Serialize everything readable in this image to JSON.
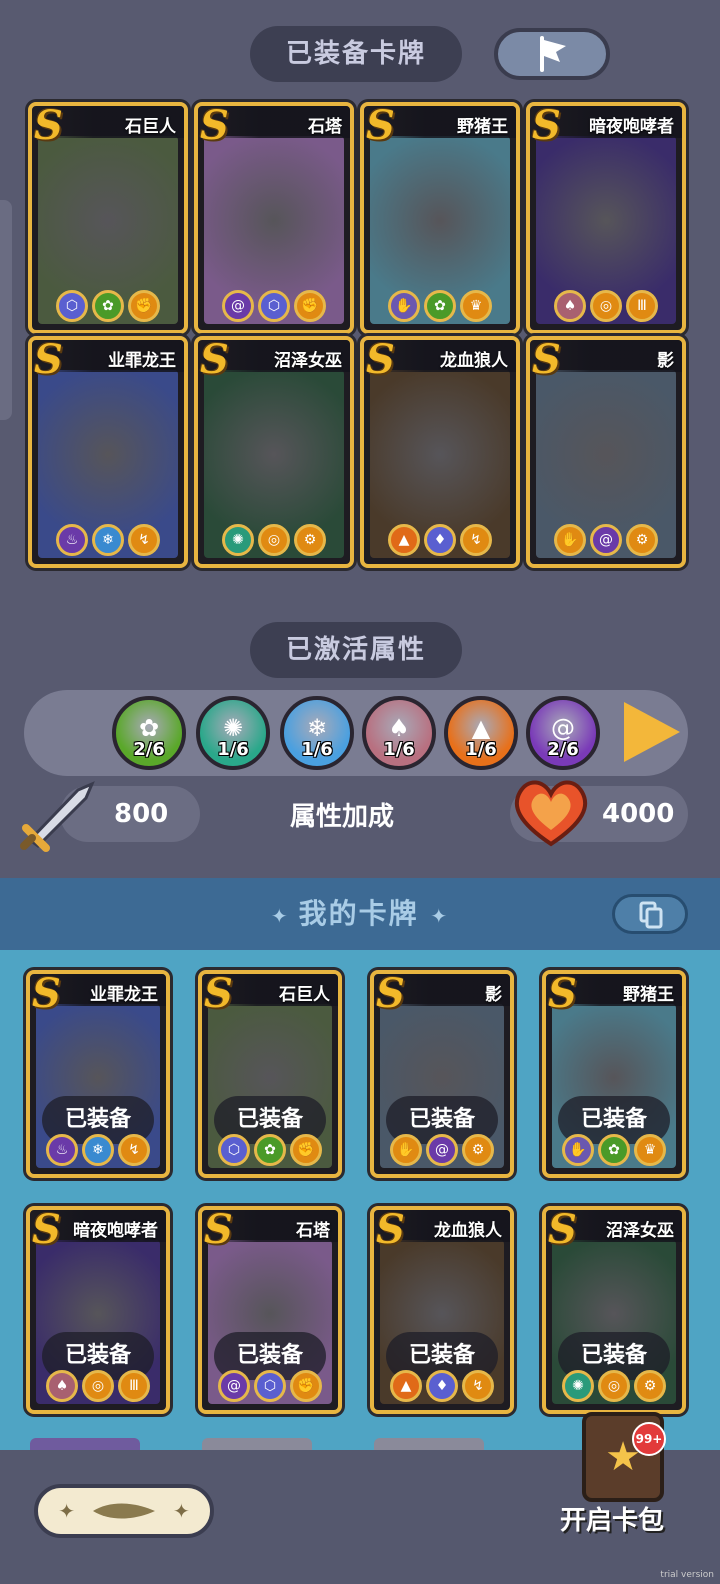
{
  "equipped_section": {
    "title": "已装备卡牌",
    "cards": [
      {
        "rank": "S",
        "name": "石巨人",
        "art": "#4b5a3f",
        "icons": [
          {
            "name": "rock-shield-icon",
            "color": "#5a5fd0",
            "glyph": "⬡"
          },
          {
            "name": "grass-icon",
            "color": "#4a9a28",
            "glyph": "✿"
          },
          {
            "name": "fist-icon",
            "color": "#e08a12",
            "glyph": "✊"
          }
        ]
      },
      {
        "rank": "S",
        "name": "石塔",
        "art": "#7a5a8a",
        "icons": [
          {
            "name": "vortex-icon",
            "color": "#6a3aa8",
            "glyph": "@"
          },
          {
            "name": "rock-shield-icon",
            "color": "#5a5fd0",
            "glyph": "⬡"
          },
          {
            "name": "fist-icon",
            "color": "#e08a12",
            "glyph": "✊"
          }
        ]
      },
      {
        "rank": "S",
        "name": "野猪王",
        "art": "#4a7a8a",
        "icons": [
          {
            "name": "paw-icon",
            "color": "#6a58b0",
            "glyph": "✋"
          },
          {
            "name": "grass-icon",
            "color": "#4a9a28",
            "glyph": "✿"
          },
          {
            "name": "crown-icon",
            "color": "#e08a12",
            "glyph": "♛"
          }
        ]
      },
      {
        "rank": "S",
        "name": "暗夜咆哮者",
        "art": "#3a2c6a",
        "icons": [
          {
            "name": "squid-icon",
            "color": "#a86070",
            "glyph": "♠"
          },
          {
            "name": "swirl-icon",
            "color": "#e08a12",
            "glyph": "◎"
          },
          {
            "name": "pillar-icon",
            "color": "#e08a12",
            "glyph": "Ⅲ"
          }
        ]
      },
      {
        "rank": "S",
        "name": "业罪龙王",
        "art": "#3a4a8a",
        "icons": [
          {
            "name": "flame-icon",
            "color": "#6a3aa8",
            "glyph": "♨"
          },
          {
            "name": "ice-icon",
            "color": "#3a8ad0",
            "glyph": "❄"
          },
          {
            "name": "claw-icon",
            "color": "#e08a12",
            "glyph": "↯"
          }
        ]
      },
      {
        "rank": "S",
        "name": "沼泽女巫",
        "art": "#2a4a38",
        "icons": [
          {
            "name": "splash-icon",
            "color": "#2a9a7a",
            "glyph": "✺"
          },
          {
            "name": "swirl-icon",
            "color": "#e08a12",
            "glyph": "◎"
          },
          {
            "name": "gear-icon",
            "color": "#e08a12",
            "glyph": "⚙"
          }
        ]
      },
      {
        "rank": "S",
        "name": "龙血狼人",
        "art": "#4a3a2a",
        "icons": [
          {
            "name": "volcano-icon",
            "color": "#e06a18",
            "glyph": "▲"
          },
          {
            "name": "flame-drop-icon",
            "color": "#5a5fd0",
            "glyph": "♦"
          },
          {
            "name": "claw-icon",
            "color": "#e08a12",
            "glyph": "↯"
          }
        ]
      },
      {
        "rank": "S",
        "name": "影",
        "art": "#4a5868",
        "icons": [
          {
            "name": "hand-icon",
            "color": "#e08a12",
            "glyph": "✋"
          },
          {
            "name": "vortex-icon",
            "color": "#6a3aa8",
            "glyph": "@"
          },
          {
            "name": "gear-icon",
            "color": "#e08a12",
            "glyph": "⚙"
          }
        ]
      }
    ]
  },
  "activated_section": {
    "title": "已激活属性",
    "attributes": [
      {
        "name": "grass",
        "count": "2/6",
        "color": "#5aa82a",
        "glyph": "✿"
      },
      {
        "name": "splash",
        "count": "1/6",
        "color": "#2aa88a",
        "glyph": "✺"
      },
      {
        "name": "ice",
        "count": "1/6",
        "color": "#4aa0e0",
        "glyph": "❄"
      },
      {
        "name": "squid",
        "count": "1/6",
        "color": "#b87080",
        "glyph": "♠"
      },
      {
        "name": "volcano",
        "count": "1/6",
        "color": "#e8701a",
        "glyph": "▲"
      },
      {
        "name": "vortex",
        "count": "2/6",
        "color": "#7a3ab8",
        "glyph": "@"
      }
    ],
    "attack": "800",
    "bonus_label": "属性加成",
    "health": "4000"
  },
  "my_cards_section": {
    "title": "我的卡牌",
    "equipped_label": "已装备",
    "cards": [
      {
        "rank": "S",
        "name": "业罪龙王",
        "art": "#3a4a8a",
        "icons": [
          {
            "name": "flame-icon",
            "color": "#6a3aa8",
            "glyph": "♨"
          },
          {
            "name": "ice-icon",
            "color": "#3a8ad0",
            "glyph": "❄"
          },
          {
            "name": "claw-icon",
            "color": "#e08a12",
            "glyph": "↯"
          }
        ]
      },
      {
        "rank": "S",
        "name": "石巨人",
        "art": "#4b5a3f",
        "icons": [
          {
            "name": "rock-shield-icon",
            "color": "#5a5fd0",
            "glyph": "⬡"
          },
          {
            "name": "grass-icon",
            "color": "#4a9a28",
            "glyph": "✿"
          },
          {
            "name": "fist-icon",
            "color": "#e08a12",
            "glyph": "✊"
          }
        ]
      },
      {
        "rank": "S",
        "name": "影",
        "art": "#4a5868",
        "icons": [
          {
            "name": "hand-icon",
            "color": "#e08a12",
            "glyph": "✋"
          },
          {
            "name": "vortex-icon",
            "color": "#6a3aa8",
            "glyph": "@"
          },
          {
            "name": "gear-icon",
            "color": "#e08a12",
            "glyph": "⚙"
          }
        ]
      },
      {
        "rank": "S",
        "name": "野猪王",
        "art": "#4a7a8a",
        "icons": [
          {
            "name": "paw-icon",
            "color": "#6a58b0",
            "glyph": "✋"
          },
          {
            "name": "grass-icon",
            "color": "#4a9a28",
            "glyph": "✿"
          },
          {
            "name": "crown-icon",
            "color": "#e08a12",
            "glyph": "♛"
          }
        ]
      },
      {
        "rank": "S",
        "name": "暗夜咆哮者",
        "art": "#3a2c6a",
        "icons": [
          {
            "name": "squid-icon",
            "color": "#a86070",
            "glyph": "♠"
          },
          {
            "name": "swirl-icon",
            "color": "#e08a12",
            "glyph": "◎"
          },
          {
            "name": "pillar-icon",
            "color": "#e08a12",
            "glyph": "Ⅲ"
          }
        ]
      },
      {
        "rank": "S",
        "name": "石塔",
        "art": "#7a5a8a",
        "icons": [
          {
            "name": "vortex-icon",
            "color": "#6a3aa8",
            "glyph": "@"
          },
          {
            "name": "rock-shield-icon",
            "color": "#5a5fd0",
            "glyph": "⬡"
          },
          {
            "name": "fist-icon",
            "color": "#e08a12",
            "glyph": "✊"
          }
        ]
      },
      {
        "rank": "S",
        "name": "龙血狼人",
        "art": "#4a3a2a",
        "icons": [
          {
            "name": "volcano-icon",
            "color": "#e06a18",
            "glyph": "▲"
          },
          {
            "name": "flame-drop-icon",
            "color": "#5a5fd0",
            "glyph": "♦"
          },
          {
            "name": "claw-icon",
            "color": "#e08a12",
            "glyph": "↯"
          }
        ]
      },
      {
        "rank": "S",
        "name": "沼泽女巫",
        "art": "#2a4a38",
        "icons": [
          {
            "name": "splash-icon",
            "color": "#2a9a7a",
            "glyph": "✺"
          },
          {
            "name": "swirl-icon",
            "color": "#e08a12",
            "glyph": "◎"
          },
          {
            "name": "gear-icon",
            "color": "#e08a12",
            "glyph": "⚙"
          }
        ]
      }
    ]
  },
  "bottom": {
    "open_pack_label": "开启卡包",
    "badge": "99+",
    "watermark": "trial version"
  }
}
